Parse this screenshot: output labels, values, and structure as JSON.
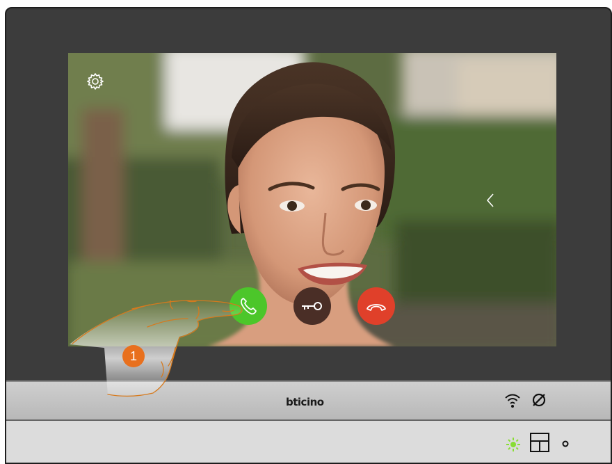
{
  "screen": {
    "settings_icon": "gear-icon",
    "nav_icon": "chevron-left-icon"
  },
  "call_controls": {
    "answer_icon": "phone-answer-icon",
    "answer_color": "#4cc62a",
    "door_lock_icon": "key-icon",
    "door_lock_color": "#4a2e26",
    "hangup_icon": "phone-hangup-icon",
    "hangup_color": "#e0402a"
  },
  "brand": {
    "name": "bticino"
  },
  "status": {
    "wifi_icon": "wifi-icon",
    "mute_icon": "ringer-off-icon"
  },
  "base": {
    "led_icon": "led-sun-icon",
    "led_color": "#88dd33",
    "touch_key_icon": "grid-key-icon",
    "dot_icon": "small-ring-icon"
  },
  "annotation": {
    "step_number": "1",
    "step_color": "#e8701e"
  }
}
